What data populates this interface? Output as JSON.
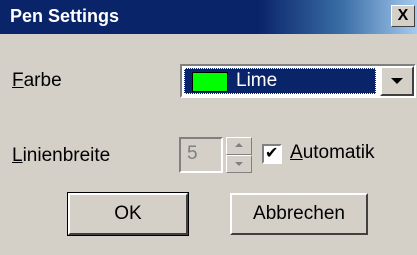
{
  "dialog": {
    "title": "Pen Settings",
    "close_label": "X"
  },
  "color": {
    "label_accel": "F",
    "label_rest": "arbe",
    "selected_name": "Lime",
    "selected_hex": "#00ff00"
  },
  "width": {
    "label_accel": "L",
    "label_rest": "inienbreite",
    "value": "5"
  },
  "auto": {
    "checked": true,
    "label_accel": "A",
    "label_rest": "utomatik"
  },
  "buttons": {
    "ok_label": "OK",
    "cancel_label": "Abbrechen"
  },
  "theme": {
    "dialog_bg": "#d4d0c8",
    "title_bg": "#0a246a",
    "selection_bg": "#0a246a"
  }
}
